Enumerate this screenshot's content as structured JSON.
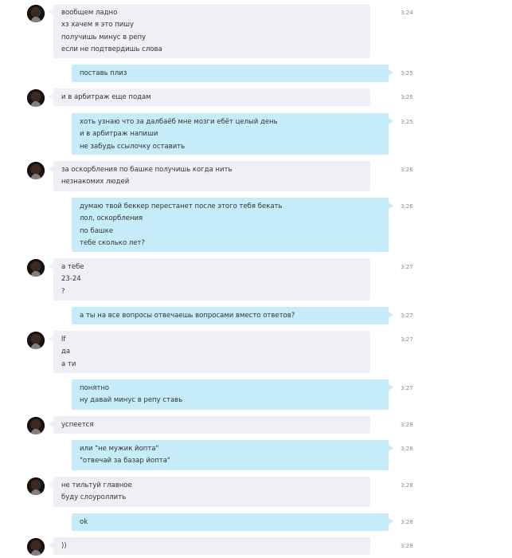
{
  "conversation": {
    "messages": [
      {
        "dir": "in",
        "time": "3:24",
        "lines": [
          "вообщем ладно",
          "хз хачем я это пишу",
          "получишь минус в репу",
          "если не подтвердишь слова"
        ]
      },
      {
        "dir": "out",
        "time": "3:25",
        "lines": [
          "поставь плиз"
        ]
      },
      {
        "dir": "in",
        "time": "3:25",
        "lines": [
          "и в арбитраж еще подам"
        ]
      },
      {
        "dir": "out",
        "time": "3:25",
        "lines": [
          "хоть узнаю что за далбаёб мне мозги ебёт целый день",
          "и в арбитраж напиши",
          "не забудь ссылочку оставить"
        ]
      },
      {
        "dir": "in",
        "time": "3:26",
        "lines": [
          "за оскорбления по башке получишь когда нить",
          "незнакомих людей"
        ]
      },
      {
        "dir": "out",
        "time": "3:26",
        "lines": [
          "думаю твой беккер перестанет после этого тебя бекать",
          "лол, оскорбления",
          "по башке",
          "тебе сколько лет?"
        ]
      },
      {
        "dir": "in",
        "time": "3:27",
        "lines": [
          "а тебе",
          "23-24",
          "?"
        ]
      },
      {
        "dir": "out",
        "time": "3:27",
        "lines": [
          "а ты на все вопросы отвечаешь вопросами вместо ответов?"
        ]
      },
      {
        "dir": "in",
        "time": "3:27",
        "lines": [
          "lf",
          "да",
          "а ти"
        ]
      },
      {
        "dir": "out",
        "time": "3:27",
        "lines": [
          "понятно",
          "ну давай минус в репу ставь"
        ]
      },
      {
        "dir": "in",
        "time": "3:28",
        "lines": [
          "успеется"
        ]
      },
      {
        "dir": "out",
        "time": "3:28",
        "lines": [
          "или \"не мужик йопта\"",
          "\"отвечай за базар йопта\""
        ]
      },
      {
        "dir": "in",
        "time": "3:28",
        "lines": [
          "не тильтуй главное",
          "буду слоуроллить"
        ]
      },
      {
        "dir": "out",
        "time": "3:28",
        "lines": [
          "ok"
        ]
      },
      {
        "dir": "in",
        "time": "3:28",
        "lines": [
          "))"
        ]
      }
    ]
  },
  "icons": {
    "avatar": "contact-avatar-icon"
  },
  "colors": {
    "incoming_bubble": "#eef0f5",
    "outgoing_bubble": "#c6ecf9",
    "timestamp": "#8a8a8a",
    "text": "#333333"
  }
}
